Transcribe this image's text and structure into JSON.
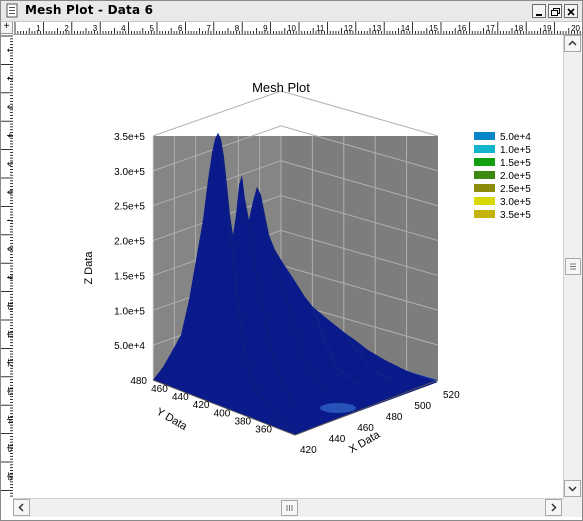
{
  "window": {
    "title": "Mesh Plot - Data 6"
  },
  "rulers": {
    "horizontal": [
      "1",
      "2",
      "3",
      "4",
      "5",
      "6",
      "7",
      "8",
      "9",
      "10",
      "11",
      "12",
      "13",
      "14",
      "15",
      "16",
      "17",
      "18",
      "19",
      "20"
    ],
    "vertical": [
      "1",
      "2",
      "3",
      "4",
      "5",
      "6",
      "7",
      "8",
      "9",
      "10",
      "11",
      "12",
      "13",
      "14",
      "15",
      "16",
      "17",
      "18",
      "19",
      "20",
      "21"
    ],
    "corner": "+"
  },
  "colors": {
    "wall": "#858585",
    "floor_dark": "#00107a",
    "accent": "#0a246a"
  },
  "chart_data": {
    "type": "surface",
    "title": "Mesh Plot",
    "xlabel": "X Data",
    "ylabel": "Y Data",
    "zlabel": "Z Data",
    "x_ticks": [
      "420",
      "440",
      "460",
      "480",
      "500",
      "520"
    ],
    "y_ticks": [
      "360",
      "380",
      "400",
      "420",
      "440",
      "460",
      "480"
    ],
    "z_ticks": [
      "5.0e+4",
      "1.0e+5",
      "1.5e+5",
      "2.0e+5",
      "2.5e+5",
      "3.0e+5",
      "3.5e+5"
    ],
    "xlim": [
      420,
      520
    ],
    "ylim": [
      360,
      480
    ],
    "zlim": [
      0,
      350000
    ],
    "legend": [
      {
        "label": "5.0e+4",
        "color": "#0a86c8"
      },
      {
        "label": "1.0e+5",
        "color": "#12b4cc"
      },
      {
        "label": "1.5e+5",
        "color": "#12a012"
      },
      {
        "label": "2.0e+5",
        "color": "#3c8a12"
      },
      {
        "label": "2.5e+5",
        "color": "#8c8c0c"
      },
      {
        "label": "3.0e+5",
        "color": "#d8d806"
      },
      {
        "label": "3.5e+5",
        "color": "#c4b40c"
      }
    ],
    "legend_position": "top-right",
    "grid": true,
    "peaks": [
      {
        "x": 421,
        "y": 462,
        "z": 345000
      },
      {
        "x": 434,
        "y": 446,
        "z": 270000
      },
      {
        "x": 444,
        "y": 438,
        "z": 285000
      },
      {
        "x": 458,
        "y": 430,
        "z": 220000
      },
      {
        "x": 486,
        "y": 410,
        "z": 95000
      },
      {
        "x": 498,
        "y": 402,
        "z": 80000
      }
    ]
  }
}
